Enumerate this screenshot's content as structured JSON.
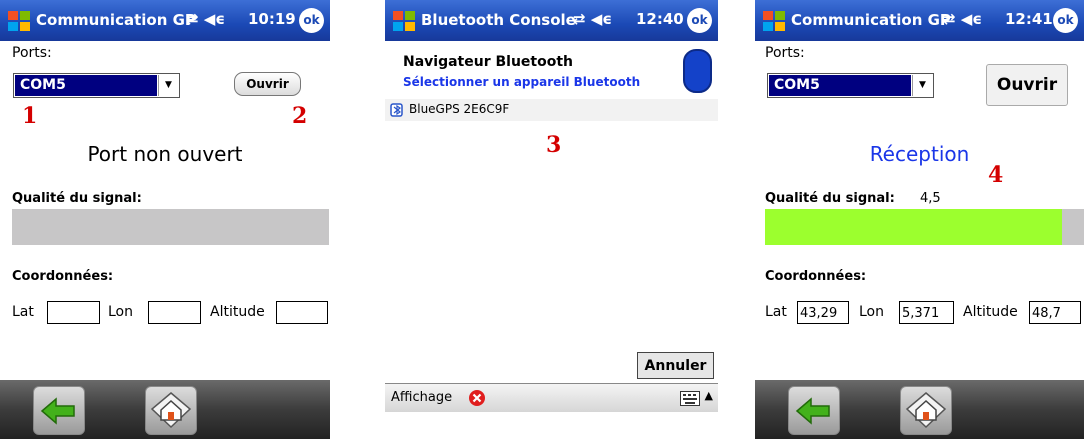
{
  "screen1": {
    "title": "Communication GP",
    "status_icons": "⇄ ◀ϵ",
    "time": "10:19",
    "ok": "ok",
    "ports_label": "Ports:",
    "port_value": "COM5",
    "open_button": "Ouvrir",
    "marker_1": "1",
    "marker_2": "2",
    "status": "Port non ouvert",
    "signal_label": "Qualité du signal:",
    "signal_fraction": 0,
    "coords_label": "Coordonnées:",
    "lat_label": "Lat",
    "lon_label": "Lon",
    "alt_label": "Altitude",
    "lat_value": "",
    "lon_value": "",
    "alt_value": ""
  },
  "screen2": {
    "title": "Bluetooth Console",
    "status_icons": "⇄ ◀ϵ",
    "time": "12:40",
    "ok": "ok",
    "header_title": "Navigateur Bluetooth",
    "header_subtitle": "Sélectionner un appareil Bluetooth",
    "device": "BlueGPS 2E6C9F",
    "marker_3": "3",
    "cancel_button": "Annuler",
    "menu_label": "Affichage"
  },
  "screen3": {
    "title": "Communication GP",
    "status_icons": "⇄ ◀ϵ",
    "time": "12:41",
    "ok": "ok",
    "ports_label": "Ports:",
    "port_value": "COM5",
    "open_button": "Ouvrir",
    "status": "Réception",
    "marker_4": "4",
    "signal_label": "Qualité du signal:",
    "signal_value": "4,5",
    "signal_fraction": 0.93,
    "coords_label": "Coordonnées:",
    "lat_label": "Lat",
    "lon_label": "Lon",
    "alt_label": "Altitude",
    "lat_value": "43,29",
    "lon_value": "5,371",
    "alt_value": "48,7"
  },
  "colors": {
    "titlebar": "#1b49b5",
    "selection": "#000080",
    "status_blue": "#1a36e8",
    "marker_red": "#d40000",
    "signal_fill": "#9cff2e",
    "signal_track": "#c7c6c7"
  },
  "icons": [
    "windows-logo-icon",
    "connectivity-icon",
    "volume-icon",
    "back-arrow-icon",
    "home-icon",
    "bluetooth-device-icon",
    "close-icon",
    "keyboard-icon"
  ]
}
